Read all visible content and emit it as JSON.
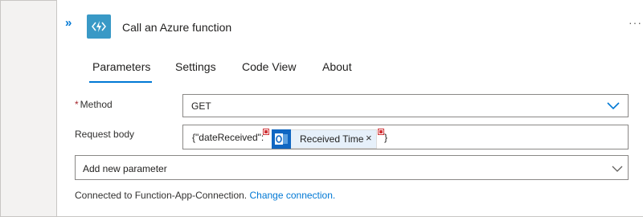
{
  "action": {
    "title": "Call an Azure function",
    "more_label": "···",
    "collapse_label": "»"
  },
  "tabs": [
    {
      "label": "Parameters",
      "active": true
    },
    {
      "label": "Settings"
    },
    {
      "label": "Code View"
    },
    {
      "label": "About"
    }
  ],
  "fields": {
    "method": {
      "required_mark": "*",
      "label": "Method",
      "value": "GET"
    },
    "request_body": {
      "label": "Request body",
      "prefix": "{\"dateReceived\":",
      "token_label": "Received Time",
      "token_close": "×",
      "suffix": "}"
    },
    "add_parameter": {
      "label": "Add new parameter"
    }
  },
  "footer": {
    "connected_text": "Connected to Function-App-Connection.",
    "change_link": "Change connection."
  },
  "colors": {
    "accent": "#0078d4",
    "function_icon": "#3999c6",
    "outlook_token": "#0f66c2"
  }
}
